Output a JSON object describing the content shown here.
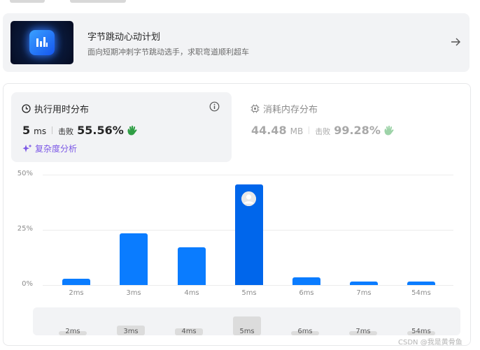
{
  "promo": {
    "title": "字节跳动心动计划",
    "subtitle": "面向短期冲刺字节跳动选手，求职弯道顺利超车",
    "icon": "bar-logo-icon",
    "action_icon": "arrow-right-icon"
  },
  "runtime": {
    "tab_label": "执行用时分布",
    "icon": "clock-icon",
    "value": "5",
    "unit": "ms",
    "beat_label": "击败",
    "beat_percent": "55.56%",
    "complexity_label": "复杂度分析",
    "info_icon": "info-icon"
  },
  "memory": {
    "tab_label": "消耗内存分布",
    "icon": "chip-icon",
    "value": "44.48",
    "unit": "MB",
    "beat_label": "击败",
    "beat_percent": "99.28%"
  },
  "colors": {
    "bar": "#0a7cff",
    "bar_selected": "#0066eb",
    "accent_purple": "#7b57e6",
    "clap_green": "#2f9e44",
    "clap_dim": "#9dd3a8"
  },
  "chart_data": {
    "type": "bar",
    "categories": [
      "2ms",
      "3ms",
      "4ms",
      "5ms",
      "6ms",
      "7ms",
      "54ms"
    ],
    "values": [
      3.0,
      23.5,
      17.0,
      45.5,
      3.5,
      1.5,
      1.5
    ],
    "selected": "5ms",
    "yticks": [
      "0%",
      "25%",
      "50%"
    ],
    "ylim": [
      0,
      50
    ],
    "grid": true
  },
  "navigator": {
    "labels": [
      "2ms",
      "3ms",
      "4ms",
      "5ms",
      "6ms",
      "7ms",
      "54ms"
    ]
  },
  "watermark": "CSDN @我是黄骨鱼"
}
